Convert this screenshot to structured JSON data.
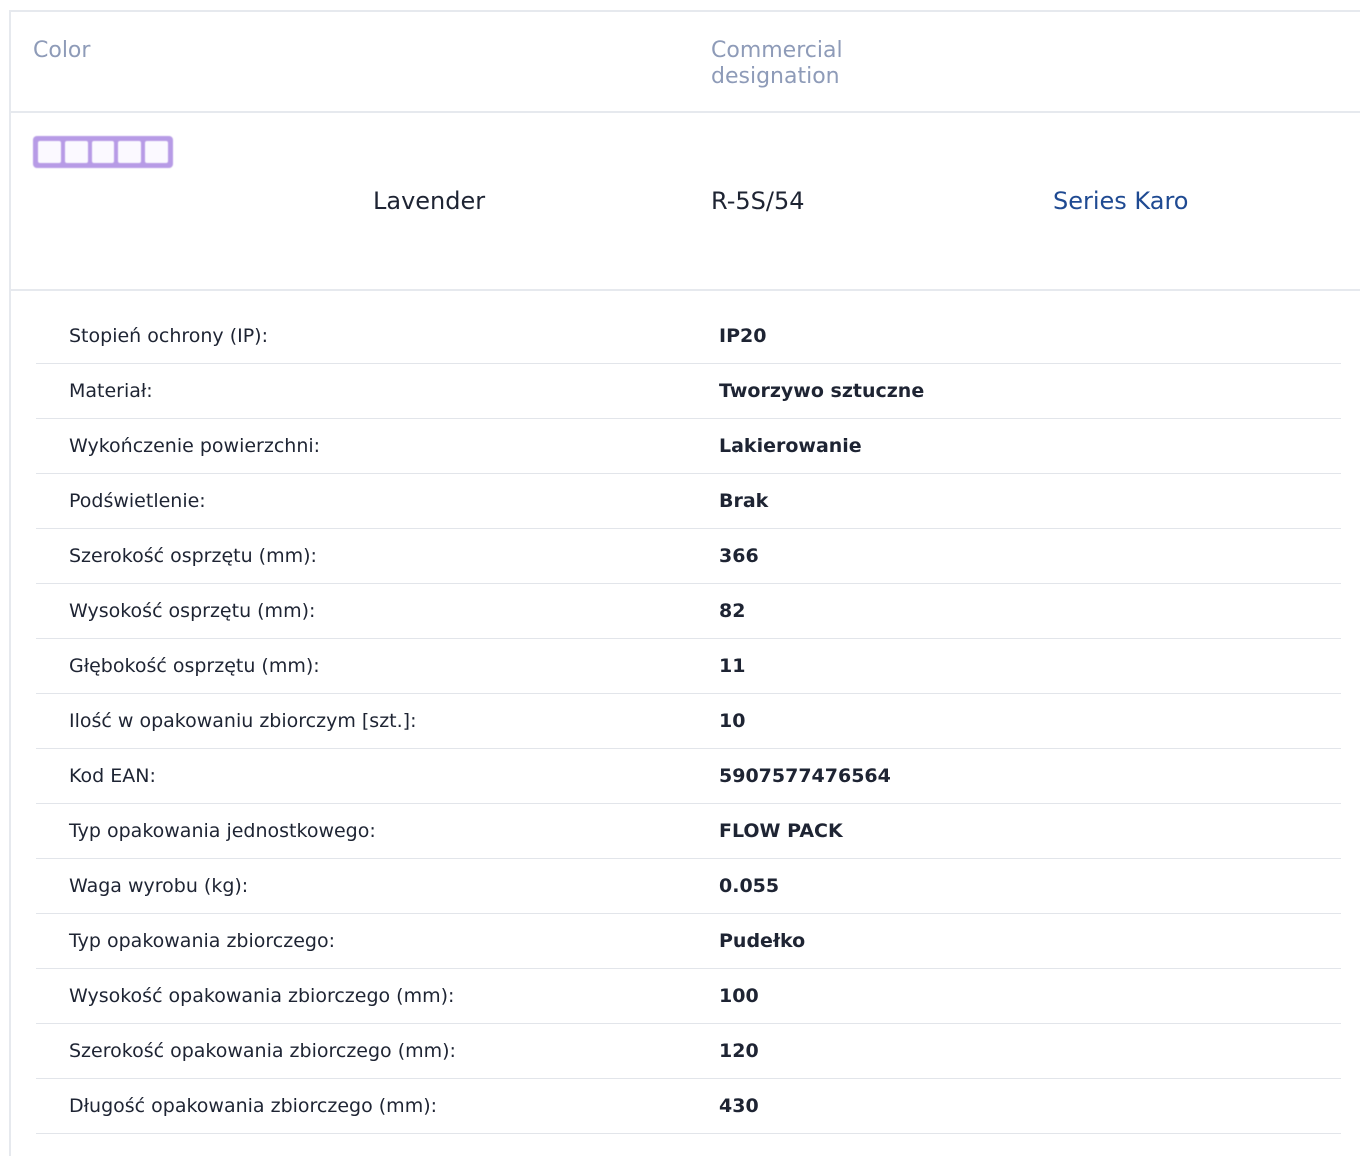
{
  "header": {
    "color_label": "Color",
    "designation_label": "Commercial designation"
  },
  "product": {
    "color_name": "Lavender",
    "code": "R-5S/54",
    "series_link": "Series Karo",
    "swatch_icon": "lavender-frame-swatch",
    "swatch_color": "#b79be6"
  },
  "specs": [
    {
      "label": "Stopień ochrony (IP):",
      "value": "IP20"
    },
    {
      "label": "Materiał:",
      "value": "Tworzywo sztuczne"
    },
    {
      "label": "Wykończenie powierzchni:",
      "value": "Lakierowanie"
    },
    {
      "label": "Podświetlenie:",
      "value": "Brak"
    },
    {
      "label": "Szerokość osprzętu (mm):",
      "value": "366"
    },
    {
      "label": "Wysokość osprzętu (mm):",
      "value": "82"
    },
    {
      "label": "Głębokość osprzętu (mm):",
      "value": "11"
    },
    {
      "label": "Ilość w opakowaniu zbiorczym [szt.]:",
      "value": "10"
    },
    {
      "label": "Kod EAN:",
      "value": "5907577476564"
    },
    {
      "label": "Typ opakowania jednostkowego:",
      "value": "FLOW PACK"
    },
    {
      "label": "Waga wyrobu (kg):",
      "value": "0.055"
    },
    {
      "label": "Typ opakowania zbiorczego:",
      "value": "Pudełko"
    },
    {
      "label": "Wysokość opakowania zbiorczego (mm):",
      "value": "100"
    },
    {
      "label": "Szerokość opakowania zbiorczego (mm):",
      "value": "120"
    },
    {
      "label": "Długość opakowania zbiorczego (mm):",
      "value": "430"
    }
  ]
}
